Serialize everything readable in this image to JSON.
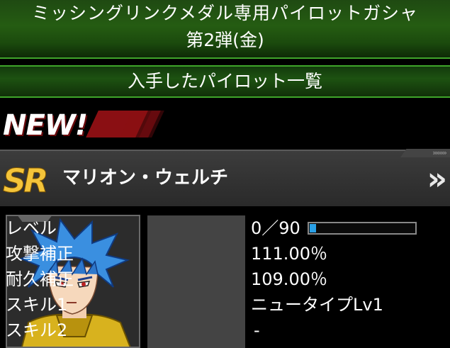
{
  "banner": {
    "line1": "ミッシングリンクメダル専用パイロットガシャ",
    "line2": "第2弾(金)"
  },
  "subbar": {
    "label": "入手したパイロット一覧"
  },
  "new_badge": {
    "text": "NEW!"
  },
  "card": {
    "rarity": "SR",
    "name": "マリオン・ウェルチ",
    "detail_arrow": "»",
    "tab_arrows": "»»»»"
  },
  "stats": [
    {
      "label": "レベル",
      "value": "0／90"
    },
    {
      "label": "攻撃補正",
      "value": "111.00％"
    },
    {
      "label": "耐久補正",
      "value": "109.00％"
    },
    {
      "label": "スキル1",
      "value": "ニュータイプLv1"
    },
    {
      "label": "スキル2",
      "value": "-"
    }
  ],
  "level_progress": 0.06,
  "colors": {
    "banner_green": "#255c12",
    "accent_green": "#3fa52a",
    "new_red": "#8a0f13",
    "rarity_gold": "#f4c43a",
    "level_blue": "#2aa0e6"
  }
}
